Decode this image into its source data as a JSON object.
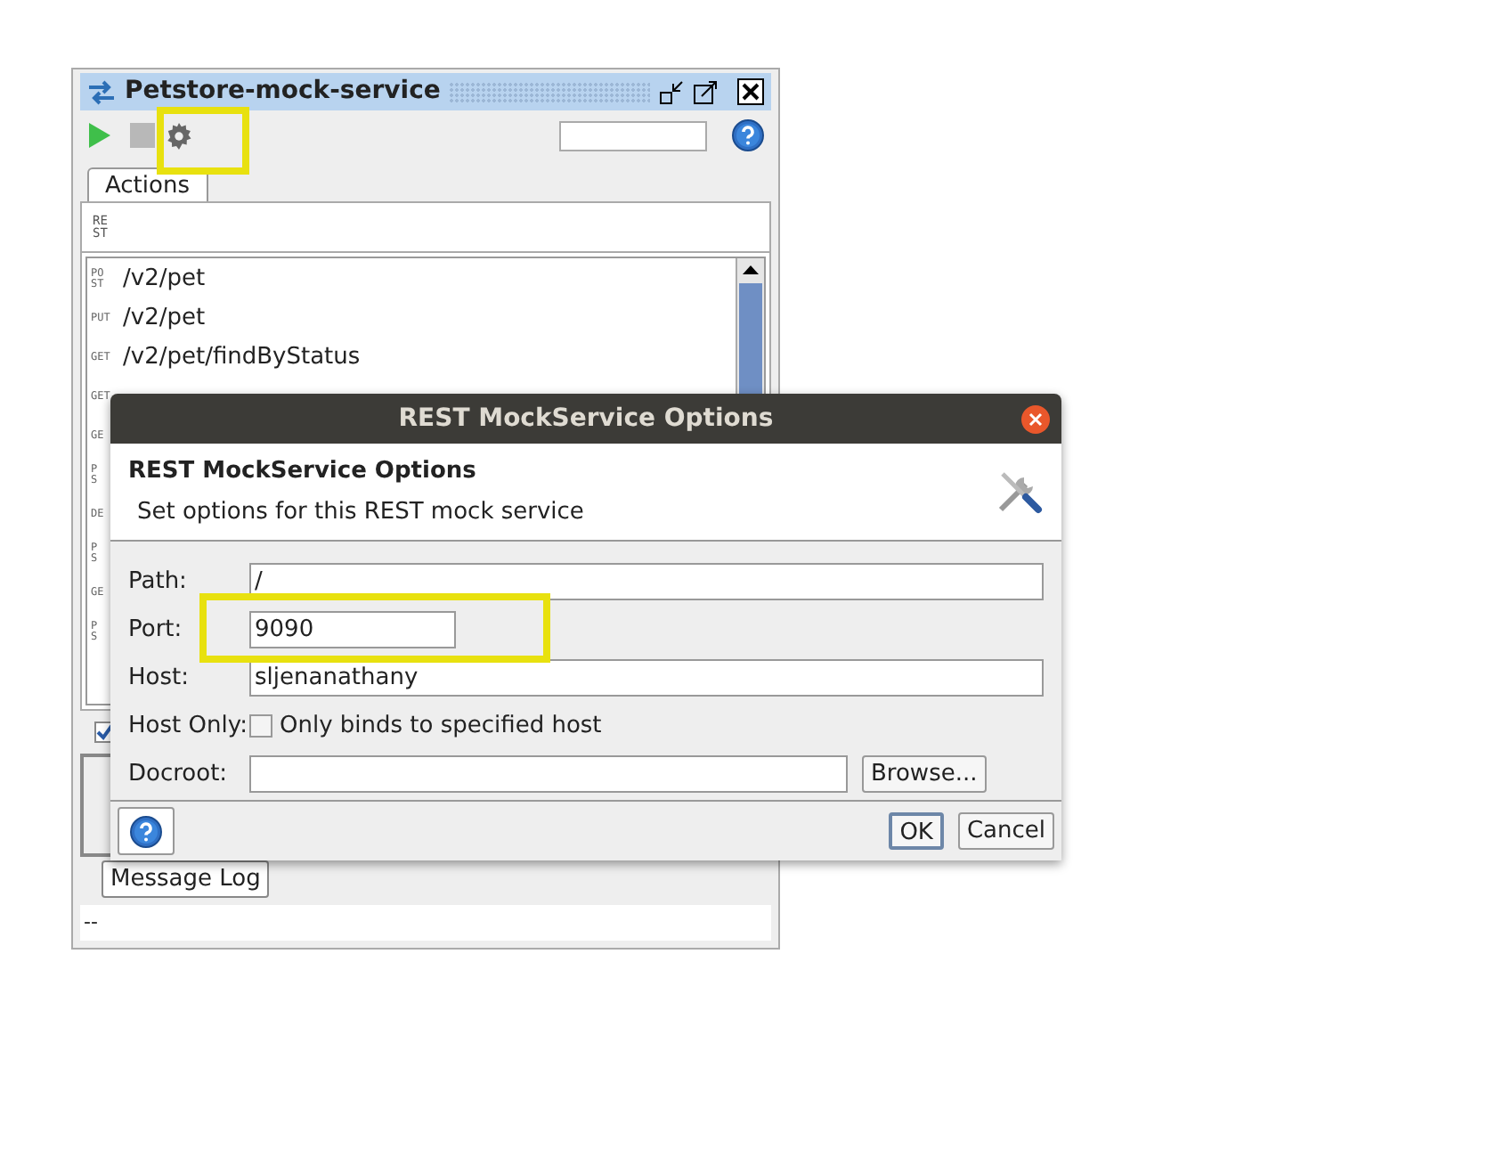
{
  "service_window": {
    "title": "Petstore-mock-service",
    "tabs": [
      {
        "label": "Actions",
        "selected": true
      }
    ],
    "header_icon": "RE ST",
    "actions": [
      {
        "method": "PO ST",
        "path": "/v2/pet"
      },
      {
        "method": "PUT",
        "path": "/v2/pet"
      },
      {
        "method": "GET",
        "path": "/v2/pet/findByStatus"
      },
      {
        "method": "GET"
      },
      {
        "method": "GE"
      },
      {
        "method": "P S"
      },
      {
        "method": "DE"
      },
      {
        "method": "P S"
      },
      {
        "method": "GE"
      },
      {
        "method": "P S"
      }
    ],
    "option_checked": true,
    "bottom_tabs": [
      {
        "label": "Message Log"
      }
    ],
    "status": "--"
  },
  "dialog": {
    "title": "REST MockService Options",
    "heading": "REST MockService Options",
    "subtitle": "Set options for this REST mock service",
    "fields": [
      {
        "kind": "text",
        "label": "Path:",
        "value": "/"
      },
      {
        "kind": "short",
        "label": "Port:",
        "value": "9090"
      },
      {
        "kind": "text",
        "label": "Host:",
        "value": "sljenanathany"
      },
      {
        "kind": "checkbox",
        "label": "Host Only:",
        "text": "Only binds to specified host",
        "checked": false
      },
      {
        "kind": "browse",
        "label": "Docroot:",
        "button": "Browse..."
      }
    ],
    "buttons": [
      {
        "label": "OK",
        "default": true
      },
      {
        "label": "Cancel",
        "default": false
      }
    ]
  }
}
